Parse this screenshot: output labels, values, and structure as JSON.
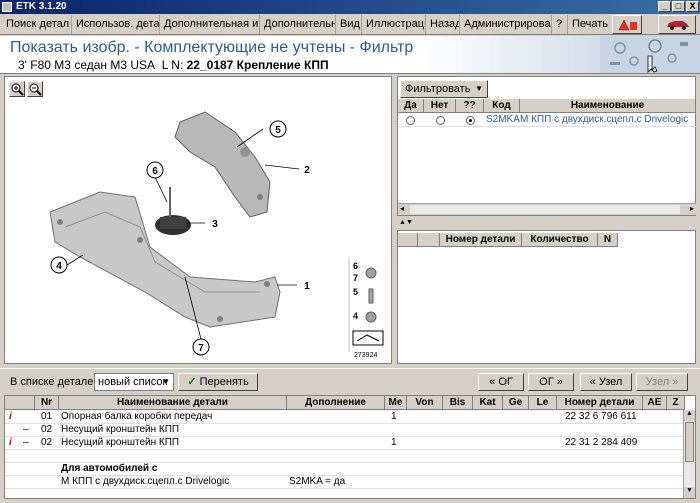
{
  "window": {
    "title": "ETK 3.1.20",
    "min": "_",
    "max": "□",
    "close": "X"
  },
  "menu": {
    "items": [
      "Поиск детал",
      "Использов. детал",
      "Дополнительная ин",
      "Дополнительн",
      "Вид",
      "Иллюстраци",
      "Назад",
      "Администрирова",
      "?",
      "Печать"
    ]
  },
  "header": {
    "title": "Показать изобр. - Комплектующие не учтены - Фильтр",
    "subtitle_model": "3' F80 M3 седан M3 USA",
    "subtitle_ln_label": "L N:",
    "subtitle_ln_value": "22_0187 Крепление КПП"
  },
  "diagram": {
    "callouts": [
      "1",
      "2",
      "3",
      "4",
      "5",
      "6",
      "7"
    ],
    "legend": [
      "6",
      "7",
      "5",
      "4"
    ],
    "image_number": "273924"
  },
  "filter": {
    "button": "Фильтровать",
    "columns": [
      "Да",
      "Нет",
      "??",
      "Код",
      "Наименование"
    ],
    "rows": [
      {
        "code": "S2MKA",
        "name": "М КПП с двухдиск.сцепл.с Drivelogic",
        "selected": "??"
      }
    ]
  },
  "parts_panel": {
    "columns": [
      "Номер детали",
      "Количество",
      "N"
    ]
  },
  "toolbar": {
    "list_label": "В списке деталей",
    "list_value": "новый список",
    "apply": "Перенять",
    "og_prev": "« ОГ",
    "og_next": "ОГ »",
    "node_prev": "« Узел",
    "node_next": "Узел »"
  },
  "parts_table": {
    "columns": [
      "Nr",
      "Наименование детали",
      "Дополнение",
      "Me",
      "Von",
      "Bis",
      "Kat",
      "Ge",
      "Le",
      "Номер детали",
      "AE",
      "Z"
    ],
    "rows": [
      {
        "info": "i",
        "dash": "",
        "nr": "01",
        "name": "Опорная балка коробки передач",
        "add": "",
        "me": "1",
        "number": "22 32 6 796 611"
      },
      {
        "info": "",
        "dash": "–",
        "nr": "02",
        "name": "Несущий кронштейн КПП",
        "add": "",
        "me": "",
        "number": ""
      },
      {
        "info": "i",
        "dash": "–",
        "nr": "02",
        "name": "Несущий кронштейн КПП",
        "add": "",
        "me": "1",
        "number": "22 31 2 284 409"
      },
      {
        "info": "",
        "dash": "",
        "nr": "",
        "name": "",
        "add": "",
        "me": "",
        "number": ""
      },
      {
        "info": "",
        "dash": "",
        "nr": "",
        "name": "Для автомобилей с",
        "add": "",
        "me": "",
        "number": ""
      },
      {
        "info": "",
        "dash": "",
        "nr": "",
        "name": "М КПП с двухдиск.сцепл.с Drivelogic",
        "add": "S2MKA = да",
        "me": "",
        "number": ""
      }
    ]
  },
  "colors": {
    "accent": "#2a5aa0",
    "info_icon": "#c00000",
    "titlebar": "#0a246a"
  }
}
